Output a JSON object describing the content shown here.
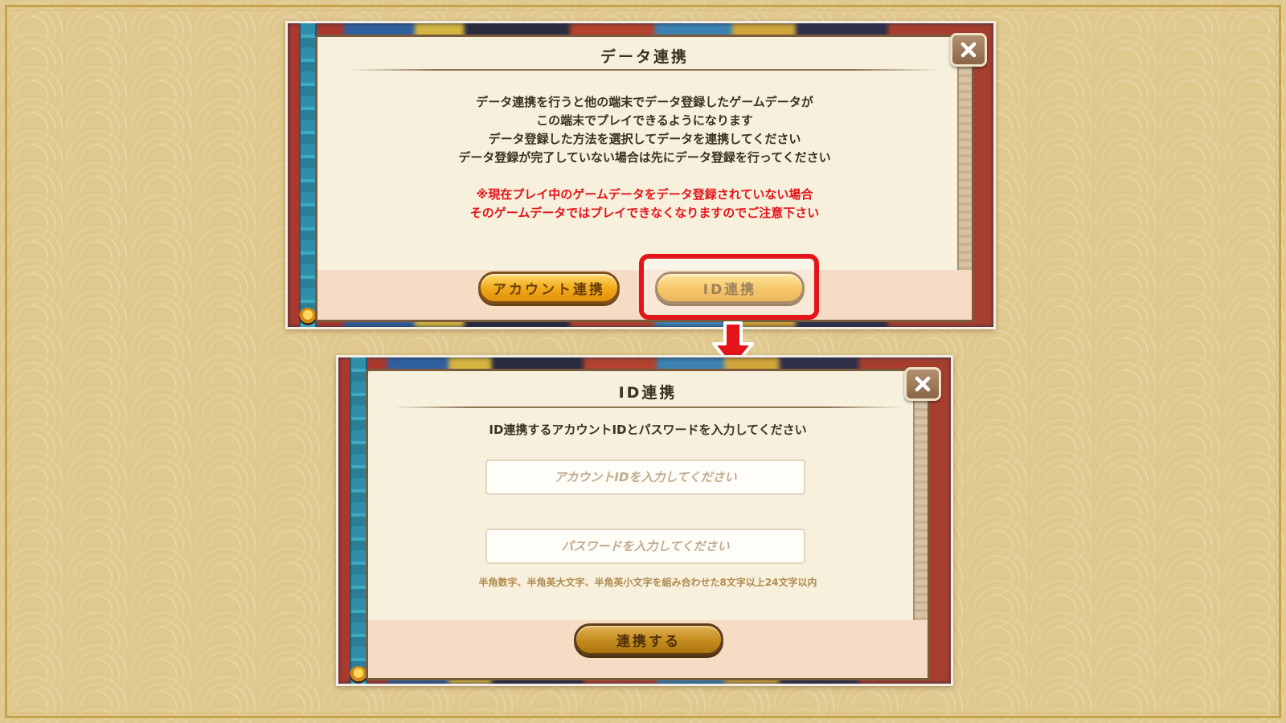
{
  "dialog1": {
    "title": "データ連携",
    "message_lines": [
      "データ連携を行うと他の端末でデータ登録したゲームデータが",
      "この端末でプレイできるようになります",
      "データ登録した方法を選択してデータを連携してください",
      "データ登録が完了していない場合は先にデータ登録を行ってください"
    ],
    "warning_lines": [
      "※現在プレイ中のゲームデータをデータ登録されていない場合",
      "そのゲームデータではプレイできなくなりますのでご注意下さい"
    ],
    "account_button_label": "アカウント連携",
    "id_button_label": "ID連携",
    "close_icon": "close-icon"
  },
  "dialog2": {
    "title": "ID連携",
    "instruction": "ID連携するアカウントIDとパスワードを入力してください",
    "account_id_placeholder": "アカウントIDを入力してください",
    "password_placeholder": "パスワードを入力してください",
    "password_hint": "半角数字、半角英大文字、半角英小文字を組み合わせた8文字以上24文字以内",
    "submit_button_label": "連携する",
    "close_icon": "close-icon"
  },
  "annotation": {
    "highlight_color": "#e3141a",
    "arrow_icon": "arrow-down-icon"
  },
  "colors": {
    "background": "#e0c98e",
    "paper": "#f7f0dc",
    "footer": "#f6dcc4",
    "button_gold": "#f1a919",
    "warning_text": "#e3141a"
  }
}
